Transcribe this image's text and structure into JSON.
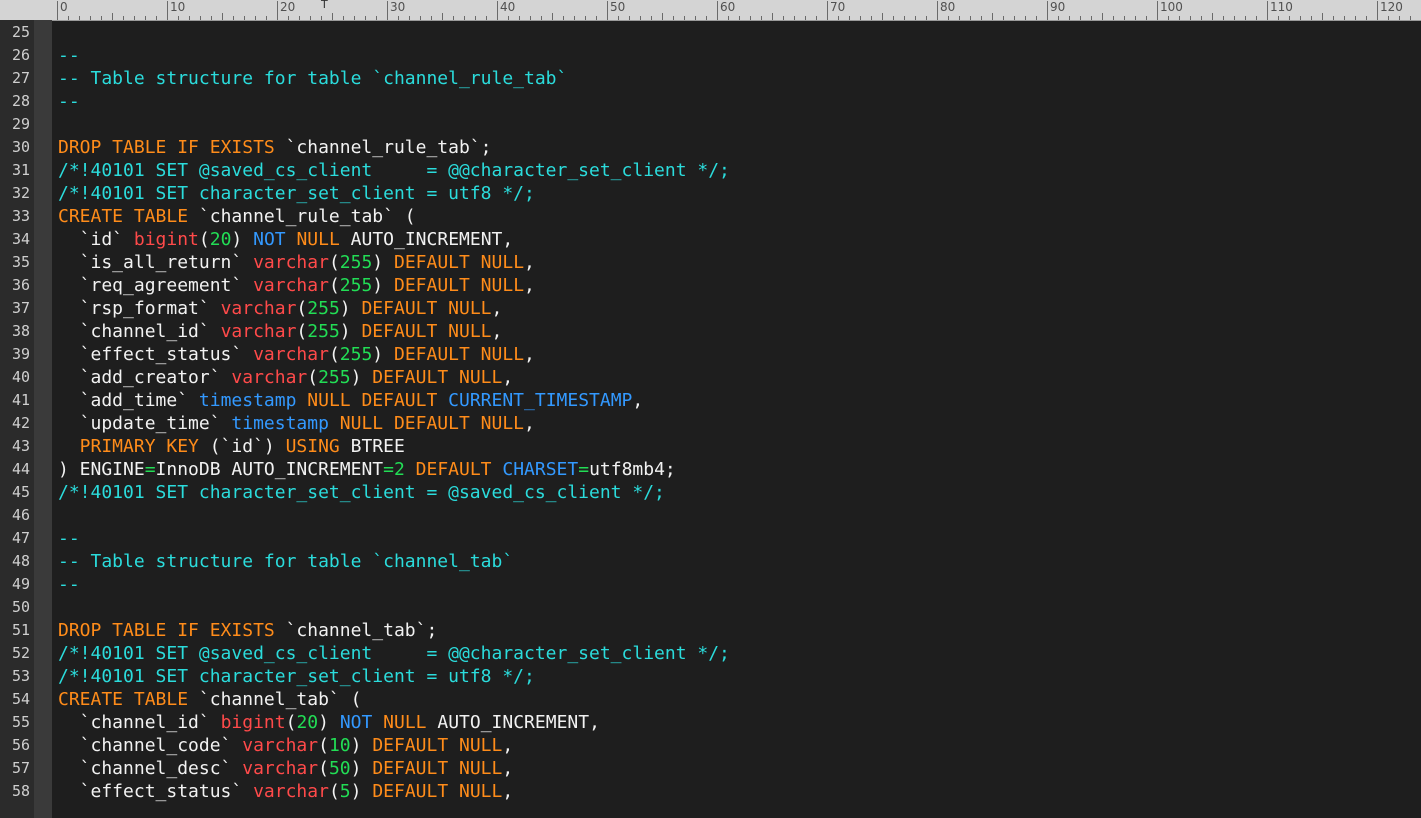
{
  "ruler": {
    "labels": [
      "0",
      "10",
      "20",
      "30",
      "40",
      "50",
      "60",
      "70",
      "80",
      "90",
      "100",
      "110",
      "120"
    ],
    "caret_marker": "T"
  },
  "colors": {
    "comment": "#2bdcdc",
    "keyword": "#ff8c1a",
    "type": "#ff4a4a",
    "number": "#22dd55",
    "constant": "#3399ff",
    "text": "#f2f2f2",
    "background": "#1e1e1e"
  },
  "lines": [
    {
      "n": "25",
      "tokens": []
    },
    {
      "n": "26",
      "tokens": [
        {
          "t": "--",
          "c": "comment"
        }
      ]
    },
    {
      "n": "27",
      "tokens": [
        {
          "t": "-- Table structure for table `channel_rule_tab`",
          "c": "comment"
        }
      ]
    },
    {
      "n": "28",
      "tokens": [
        {
          "t": "--",
          "c": "comment"
        }
      ]
    },
    {
      "n": "29",
      "tokens": []
    },
    {
      "n": "30",
      "tokens": [
        {
          "t": "DROP TABLE IF EXISTS ",
          "c": "kw"
        },
        {
          "t": "`channel_rule_tab`",
          "c": "str"
        },
        {
          "t": ";",
          "c": "plain"
        }
      ]
    },
    {
      "n": "31",
      "tokens": [
        {
          "t": "/*!40101 SET @saved_cs_client     = @@character_set_client */;",
          "c": "comment"
        }
      ]
    },
    {
      "n": "32",
      "tokens": [
        {
          "t": "/*!40101 SET character_set_client = utf8 */;",
          "c": "comment"
        }
      ]
    },
    {
      "n": "33",
      "tokens": [
        {
          "t": "CREATE TABLE ",
          "c": "kw"
        },
        {
          "t": "`channel_rule_tab`",
          "c": "str"
        },
        {
          "t": " (",
          "c": "plain"
        }
      ]
    },
    {
      "n": "34",
      "tokens": [
        {
          "t": "  `id` ",
          "c": "str"
        },
        {
          "t": "bigint",
          "c": "type"
        },
        {
          "t": "(",
          "c": "plain"
        },
        {
          "t": "20",
          "c": "num"
        },
        {
          "t": ") ",
          "c": "plain"
        },
        {
          "t": "NOT",
          "c": "blue"
        },
        {
          "t": " NULL ",
          "c": "kw"
        },
        {
          "t": "AUTO_INCREMENT,",
          "c": "plain"
        }
      ]
    },
    {
      "n": "35",
      "tokens": [
        {
          "t": "  `is_all_return` ",
          "c": "str"
        },
        {
          "t": "varchar",
          "c": "type"
        },
        {
          "t": "(",
          "c": "plain"
        },
        {
          "t": "255",
          "c": "num"
        },
        {
          "t": ") ",
          "c": "plain"
        },
        {
          "t": "DEFAULT NULL",
          "c": "kw"
        },
        {
          "t": ",",
          "c": "plain"
        }
      ]
    },
    {
      "n": "36",
      "tokens": [
        {
          "t": "  `req_agreement` ",
          "c": "str"
        },
        {
          "t": "varchar",
          "c": "type"
        },
        {
          "t": "(",
          "c": "plain"
        },
        {
          "t": "255",
          "c": "num"
        },
        {
          "t": ") ",
          "c": "plain"
        },
        {
          "t": "DEFAULT NULL",
          "c": "kw"
        },
        {
          "t": ",",
          "c": "plain"
        }
      ]
    },
    {
      "n": "37",
      "tokens": [
        {
          "t": "  `rsp_format` ",
          "c": "str"
        },
        {
          "t": "varchar",
          "c": "type"
        },
        {
          "t": "(",
          "c": "plain"
        },
        {
          "t": "255",
          "c": "num"
        },
        {
          "t": ") ",
          "c": "plain"
        },
        {
          "t": "DEFAULT NULL",
          "c": "kw"
        },
        {
          "t": ",",
          "c": "plain"
        }
      ]
    },
    {
      "n": "38",
      "tokens": [
        {
          "t": "  `channel_id` ",
          "c": "str"
        },
        {
          "t": "varchar",
          "c": "type"
        },
        {
          "t": "(",
          "c": "plain"
        },
        {
          "t": "255",
          "c": "num"
        },
        {
          "t": ") ",
          "c": "plain"
        },
        {
          "t": "DEFAULT NULL",
          "c": "kw"
        },
        {
          "t": ",",
          "c": "plain"
        }
      ]
    },
    {
      "n": "39",
      "tokens": [
        {
          "t": "  `effect_status` ",
          "c": "str"
        },
        {
          "t": "varchar",
          "c": "type"
        },
        {
          "t": "(",
          "c": "plain"
        },
        {
          "t": "255",
          "c": "num"
        },
        {
          "t": ") ",
          "c": "plain"
        },
        {
          "t": "DEFAULT NULL",
          "c": "kw"
        },
        {
          "t": ",",
          "c": "plain"
        }
      ]
    },
    {
      "n": "40",
      "tokens": [
        {
          "t": "  `add_creator` ",
          "c": "str"
        },
        {
          "t": "varchar",
          "c": "type"
        },
        {
          "t": "(",
          "c": "plain"
        },
        {
          "t": "255",
          "c": "num"
        },
        {
          "t": ") ",
          "c": "plain"
        },
        {
          "t": "DEFAULT NULL",
          "c": "kw"
        },
        {
          "t": ",",
          "c": "plain"
        }
      ]
    },
    {
      "n": "41",
      "tokens": [
        {
          "t": "  `add_time` ",
          "c": "str"
        },
        {
          "t": "timestamp",
          "c": "blue"
        },
        {
          "t": " NULL DEFAULT ",
          "c": "kw"
        },
        {
          "t": "CURRENT_TIMESTAMP",
          "c": "blue"
        },
        {
          "t": ",",
          "c": "plain"
        }
      ]
    },
    {
      "n": "42",
      "tokens": [
        {
          "t": "  `update_time` ",
          "c": "str"
        },
        {
          "t": "timestamp",
          "c": "blue"
        },
        {
          "t": " NULL DEFAULT NULL",
          "c": "kw"
        },
        {
          "t": ",",
          "c": "plain"
        }
      ]
    },
    {
      "n": "43",
      "tokens": [
        {
          "t": "  PRIMARY KEY ",
          "c": "kw"
        },
        {
          "t": "(`id`) ",
          "c": "str"
        },
        {
          "t": "USING",
          "c": "kw"
        },
        {
          "t": " BTREE",
          "c": "plain"
        }
      ]
    },
    {
      "n": "44",
      "tokens": [
        {
          "t": ") ENGINE",
          "c": "plain"
        },
        {
          "t": "=",
          "c": "op"
        },
        {
          "t": "InnoDB AUTO_INCREMENT",
          "c": "plain"
        },
        {
          "t": "=",
          "c": "op"
        },
        {
          "t": "2",
          "c": "num"
        },
        {
          "t": " DEFAULT ",
          "c": "kw"
        },
        {
          "t": "CHARSET",
          "c": "blue"
        },
        {
          "t": "=",
          "c": "op"
        },
        {
          "t": "utf8mb4;",
          "c": "plain"
        }
      ]
    },
    {
      "n": "45",
      "tokens": [
        {
          "t": "/*!40101 SET character_set_client = @saved_cs_client */;",
          "c": "comment"
        }
      ]
    },
    {
      "n": "46",
      "tokens": []
    },
    {
      "n": "47",
      "tokens": [
        {
          "t": "--",
          "c": "comment"
        }
      ]
    },
    {
      "n": "48",
      "tokens": [
        {
          "t": "-- Table structure for table `channel_tab`",
          "c": "comment"
        }
      ]
    },
    {
      "n": "49",
      "tokens": [
        {
          "t": "--",
          "c": "comment"
        }
      ]
    },
    {
      "n": "50",
      "tokens": []
    },
    {
      "n": "51",
      "tokens": [
        {
          "t": "DROP TABLE IF EXISTS ",
          "c": "kw"
        },
        {
          "t": "`channel_tab`",
          "c": "str"
        },
        {
          "t": ";",
          "c": "plain"
        }
      ]
    },
    {
      "n": "52",
      "tokens": [
        {
          "t": "/*!40101 SET @saved_cs_client     = @@character_set_client */;",
          "c": "comment"
        }
      ]
    },
    {
      "n": "53",
      "tokens": [
        {
          "t": "/*!40101 SET character_set_client = utf8 */;",
          "c": "comment"
        }
      ]
    },
    {
      "n": "54",
      "tokens": [
        {
          "t": "CREATE TABLE ",
          "c": "kw"
        },
        {
          "t": "`channel_tab`",
          "c": "str"
        },
        {
          "t": " (",
          "c": "plain"
        }
      ]
    },
    {
      "n": "55",
      "tokens": [
        {
          "t": "  `channel_id` ",
          "c": "str"
        },
        {
          "t": "bigint",
          "c": "type"
        },
        {
          "t": "(",
          "c": "plain"
        },
        {
          "t": "20",
          "c": "num"
        },
        {
          "t": ") ",
          "c": "plain"
        },
        {
          "t": "NOT",
          "c": "blue"
        },
        {
          "t": " NULL ",
          "c": "kw"
        },
        {
          "t": "AUTO_INCREMENT,",
          "c": "plain"
        }
      ]
    },
    {
      "n": "56",
      "tokens": [
        {
          "t": "  `channel_code` ",
          "c": "str"
        },
        {
          "t": "varchar",
          "c": "type"
        },
        {
          "t": "(",
          "c": "plain"
        },
        {
          "t": "10",
          "c": "num"
        },
        {
          "t": ") ",
          "c": "plain"
        },
        {
          "t": "DEFAULT NULL",
          "c": "kw"
        },
        {
          "t": ",",
          "c": "plain"
        }
      ]
    },
    {
      "n": "57",
      "tokens": [
        {
          "t": "  `channel_desc` ",
          "c": "str"
        },
        {
          "t": "varchar",
          "c": "type"
        },
        {
          "t": "(",
          "c": "plain"
        },
        {
          "t": "50",
          "c": "num"
        },
        {
          "t": ") ",
          "c": "plain"
        },
        {
          "t": "DEFAULT NULL",
          "c": "kw"
        },
        {
          "t": ",",
          "c": "plain"
        }
      ]
    },
    {
      "n": "58",
      "tokens": [
        {
          "t": "  `effect_status` ",
          "c": "str"
        },
        {
          "t": "varchar",
          "c": "type"
        },
        {
          "t": "(",
          "c": "plain"
        },
        {
          "t": "5",
          "c": "num"
        },
        {
          "t": ") ",
          "c": "plain"
        },
        {
          "t": "DEFAULT NULL",
          "c": "kw"
        },
        {
          "t": ",",
          "c": "plain"
        }
      ]
    }
  ]
}
